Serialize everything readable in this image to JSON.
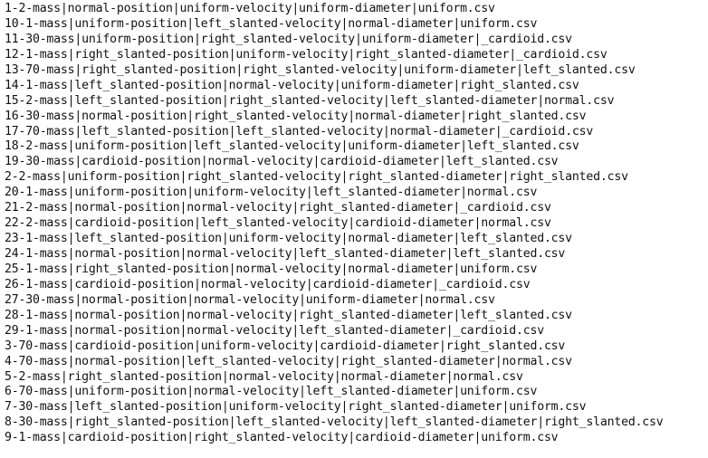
{
  "terminal": {
    "lines": [
      "1-2-mass|normal-position|uniform-velocity|uniform-diameter|uniform.csv",
      "10-1-mass|uniform-position|left_slanted-velocity|normal-diameter|uniform.csv",
      "11-30-mass|uniform-position|right_slanted-velocity|uniform-diameter|_cardioid.csv",
      "12-1-mass|right_slanted-position|uniform-velocity|right_slanted-diameter|_cardioid.csv",
      "13-70-mass|right_slanted-position|right_slanted-velocity|uniform-diameter|left_slanted.csv",
      "14-1-mass|left_slanted-position|normal-velocity|uniform-diameter|right_slanted.csv",
      "15-2-mass|left_slanted-position|right_slanted-velocity|left_slanted-diameter|normal.csv",
      "16-30-mass|normal-position|right_slanted-velocity|normal-diameter|right_slanted.csv",
      "17-70-mass|left_slanted-position|left_slanted-velocity|normal-diameter|_cardioid.csv",
      "18-2-mass|uniform-position|left_slanted-velocity|uniform-diameter|left_slanted.csv",
      "19-30-mass|cardioid-position|normal-velocity|cardioid-diameter|left_slanted.csv",
      "2-2-mass|uniform-position|right_slanted-velocity|right_slanted-diameter|right_slanted.csv",
      "20-1-mass|uniform-position|uniform-velocity|left_slanted-diameter|normal.csv",
      "21-2-mass|normal-position|normal-velocity|right_slanted-diameter|_cardioid.csv",
      "22-2-mass|cardioid-position|left_slanted-velocity|cardioid-diameter|normal.csv",
      "23-1-mass|left_slanted-position|uniform-velocity|normal-diameter|left_slanted.csv",
      "24-1-mass|normal-position|normal-velocity|left_slanted-diameter|left_slanted.csv",
      "25-1-mass|right_slanted-position|normal-velocity|normal-diameter|uniform.csv",
      "26-1-mass|cardioid-position|normal-velocity|cardioid-diameter|_cardioid.csv",
      "27-30-mass|normal-position|normal-velocity|uniform-diameter|normal.csv",
      "28-1-mass|normal-position|normal-velocity|right_slanted-diameter|left_slanted.csv",
      "29-1-mass|normal-position|normal-velocity|left_slanted-diameter|_cardioid.csv",
      "3-70-mass|cardioid-position|uniform-velocity|cardioid-diameter|right_slanted.csv",
      "4-70-mass|normal-position|left_slanted-velocity|right_slanted-diameter|normal.csv",
      "5-2-mass|right_slanted-position|normal-velocity|normal-diameter|normal.csv",
      "6-70-mass|uniform-position|normal-velocity|left_slanted-diameter|uniform.csv",
      "7-30-mass|left_slanted-position|uniform-velocity|right_slanted-diameter|uniform.csv",
      "8-30-mass|right_slanted-position|left_slanted-velocity|left_slanted-diameter|right_slanted.csv",
      "9-1-mass|cardioid-position|right_slanted-velocity|cardioid-diameter|uniform.csv"
    ]
  }
}
